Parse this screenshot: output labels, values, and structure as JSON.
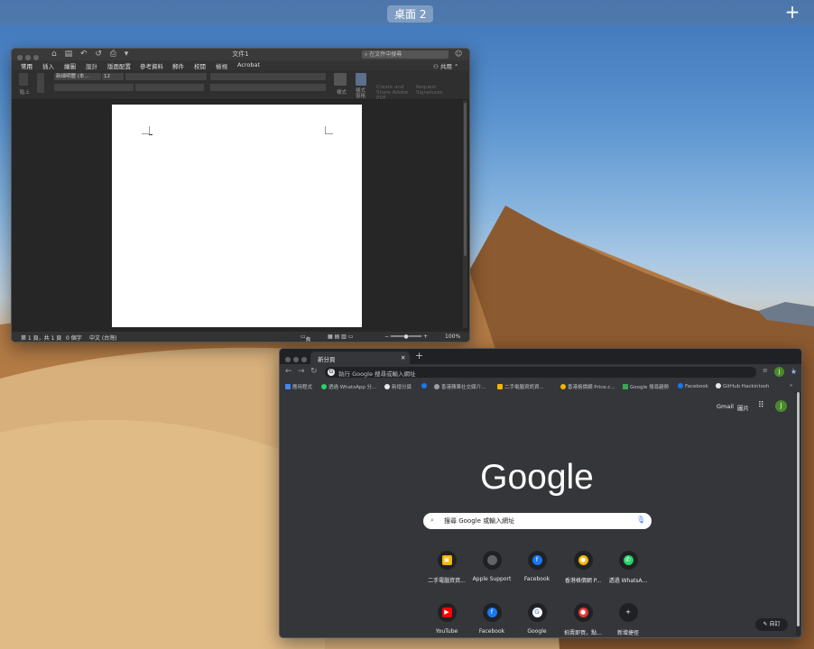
{
  "mission_control": {
    "desktop_label": "桌面 2",
    "add_desktop": "+"
  },
  "word": {
    "doc_title": "文件1",
    "search_placeholder": "在文件中搜尋",
    "share": "共用",
    "tabs": [
      "常用",
      "插入",
      "繪圖",
      "設計",
      "版面配置",
      "參考資料",
      "郵件",
      "校閱",
      "檢視",
      "Acrobat"
    ],
    "ribbon": {
      "paste": "貼上",
      "font_name": "新細明體 (本...",
      "font_size": "12",
      "styles": "樣式",
      "styles_pane": "樣式窗格",
      "create_pdf": "Create and Share Adobe PDF",
      "request_signatures": "Request Signatures"
    },
    "status": {
      "page": "第 1 頁，共 1 頁",
      "words": "0 個字",
      "language": "中文 (台灣)",
      "focus": "焦點",
      "zoom": "100%"
    }
  },
  "chrome": {
    "tab_title": "新分頁",
    "omnibox_text": "執行 Google 搜尋或輸入網址",
    "bookmarks": [
      {
        "label": "應用程式",
        "icon_color": "#4285f4"
      },
      {
        "label": "透過 WhatsApp 分...",
        "icon_color": "#25d366"
      },
      {
        "label": "新增分頁",
        "icon_color": "#e8eaed"
      },
      {
        "label": "",
        "icon_color": "#1877f2"
      },
      {
        "label": "香港蘋果社交媒介...",
        "icon_color": "#9aa0a6"
      },
      {
        "label": "二手電腦資訊資...",
        "icon_color": "#f5b400"
      },
      {
        "label": "香港格價網 Price.c...",
        "icon_color": "#f5b400"
      },
      {
        "label": "Google 搜尋趨勢",
        "icon_color": "#34a853"
      },
      {
        "label": "Facebook",
        "icon_color": "#1877f2"
      },
      {
        "label": "GitHub Hackintosh",
        "icon_color": "#e8eaed"
      }
    ],
    "top_links": {
      "gmail": "Gmail",
      "images": "圖片"
    },
    "avatar_letter": "J",
    "logo": "Google",
    "search_placeholder": "搜尋 Google 或輸入網址",
    "shortcuts": [
      {
        "label": "二手電腦資資...",
        "glyph": "▣",
        "color": "#f5b400"
      },
      {
        "label": "Apple Support",
        "glyph": "",
        "color": "#5f6368"
      },
      {
        "label": "Facebook",
        "glyph": "f",
        "color": "#1877f2"
      },
      {
        "label": "香港格價網 P...",
        "glyph": "●",
        "color": "#f5b400"
      },
      {
        "label": "透過 WhatsA...",
        "glyph": "✆",
        "color": "#25d366"
      },
      {
        "label": "YouTube",
        "glyph": "▶",
        "color": "#ff0000"
      },
      {
        "label": "Facebook",
        "glyph": "f",
        "color": "#1877f2"
      },
      {
        "label": "Google",
        "glyph": "G",
        "color": "#ffffff"
      },
      {
        "label": "拍賣即買，點...",
        "glyph": "●",
        "color": "#e53935"
      },
      {
        "label": "新增捷徑",
        "glyph": "+",
        "color": "#35363a"
      }
    ],
    "customize": "自訂"
  }
}
